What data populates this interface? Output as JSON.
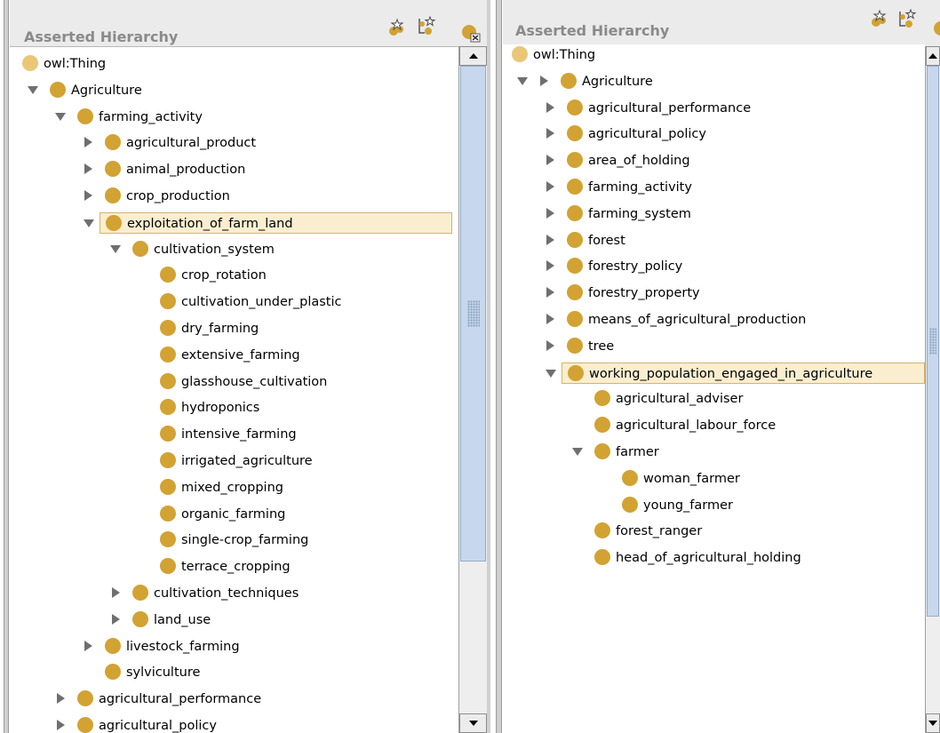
{
  "left": {
    "title": "Asserted Hierarchy",
    "tree": [
      {
        "label": "owl:Thing",
        "toggle": "none",
        "node": "light",
        "level": 0
      },
      {
        "label": "Agriculture",
        "toggle": "down",
        "node": "dark",
        "level": 1
      },
      {
        "label": "farming_activity",
        "toggle": "down",
        "node": "dark",
        "level": 2
      },
      {
        "label": "agricultural_product",
        "toggle": "right",
        "node": "dark",
        "level": 3
      },
      {
        "label": "animal_production",
        "toggle": "right",
        "node": "dark",
        "level": 3
      },
      {
        "label": "crop_production",
        "toggle": "right",
        "node": "dark",
        "level": 3
      },
      {
        "label": "exploitation_of_farm_land",
        "toggle": "down",
        "node": "dark",
        "level": 3,
        "selected": true
      },
      {
        "label": "cultivation_system",
        "toggle": "down",
        "node": "dark",
        "level": 4
      },
      {
        "label": "crop_rotation",
        "toggle": "none",
        "node": "dark",
        "level": 5
      },
      {
        "label": "cultivation_under_plastic",
        "toggle": "none",
        "node": "dark",
        "level": 5
      },
      {
        "label": "dry_farming",
        "toggle": "none",
        "node": "dark",
        "level": 5
      },
      {
        "label": "extensive_farming",
        "toggle": "none",
        "node": "dark",
        "level": 5
      },
      {
        "label": "glasshouse_cultivation",
        "toggle": "none",
        "node": "dark",
        "level": 5
      },
      {
        "label": "hydroponics",
        "toggle": "none",
        "node": "dark",
        "level": 5
      },
      {
        "label": "intensive_farming",
        "toggle": "none",
        "node": "dark",
        "level": 5
      },
      {
        "label": "irrigated_agriculture",
        "toggle": "none",
        "node": "dark",
        "level": 5
      },
      {
        "label": "mixed_cropping",
        "toggle": "none",
        "node": "dark",
        "level": 5
      },
      {
        "label": "organic_farming",
        "toggle": "none",
        "node": "dark",
        "level": 5
      },
      {
        "label": "single-crop_farming",
        "toggle": "none",
        "node": "dark",
        "level": 5
      },
      {
        "label": "terrace_cropping",
        "toggle": "none",
        "node": "dark",
        "level": 5
      },
      {
        "label": "cultivation_techniques",
        "toggle": "right",
        "node": "dark",
        "level": 4
      },
      {
        "label": "land_use",
        "toggle": "right",
        "node": "dark",
        "level": 4
      },
      {
        "label": "livestock_farming",
        "toggle": "right",
        "node": "dark",
        "level": 3
      },
      {
        "label": "sylviculture",
        "toggle": "none",
        "node": "dark",
        "level": 3
      },
      {
        "label": "agricultural_performance",
        "toggle": "right",
        "node": "dark",
        "level": 2
      },
      {
        "label": "agricultural_policy",
        "toggle": "right",
        "node": "dark",
        "level": 2
      }
    ]
  },
  "right": {
    "title": "Asserted Hierarchy",
    "tree": [
      {
        "label": "owl:Thing",
        "toggle": "none",
        "node": "light",
        "level": 0
      },
      {
        "label": "Agriculture",
        "toggle": "down",
        "toggle2": "right",
        "node": "dark",
        "level": 1
      },
      {
        "label": "agricultural_performance",
        "toggle": "right",
        "node": "dark",
        "level": 2
      },
      {
        "label": "agricultural_policy",
        "toggle": "right",
        "node": "dark",
        "level": 2
      },
      {
        "label": "area_of_holding",
        "toggle": "right",
        "node": "dark",
        "level": 2
      },
      {
        "label": "farming_activity",
        "toggle": "right",
        "node": "dark",
        "level": 2
      },
      {
        "label": "farming_system",
        "toggle": "right",
        "node": "dark",
        "level": 2
      },
      {
        "label": "forest",
        "toggle": "right",
        "node": "dark",
        "level": 2
      },
      {
        "label": "forestry_policy",
        "toggle": "right",
        "node": "dark",
        "level": 2
      },
      {
        "label": "forestry_property",
        "toggle": "right",
        "node": "dark",
        "level": 2
      },
      {
        "label": "means_of_agricultural_production",
        "toggle": "right",
        "node": "dark",
        "level": 2
      },
      {
        "label": "tree",
        "toggle": "right",
        "node": "dark",
        "level": 2
      },
      {
        "label": "working_population_engaged_in_agriculture",
        "toggle": "down",
        "node": "dark",
        "level": 2,
        "selected": true
      },
      {
        "label": "agricultural_adviser",
        "toggle": "none",
        "node": "dark",
        "level": 3
      },
      {
        "label": "agricultural_labour_force",
        "toggle": "none",
        "node": "dark",
        "level": 3
      },
      {
        "label": "farmer",
        "toggle": "down",
        "node": "dark",
        "level": 3
      },
      {
        "label": "woman_farmer",
        "toggle": "none",
        "node": "dark",
        "level": 4
      },
      {
        "label": "young_farmer",
        "toggle": "none",
        "node": "dark",
        "level": 4
      },
      {
        "label": "forest_ranger",
        "toggle": "none",
        "node": "dark",
        "level": 3
      },
      {
        "label": "head_of_agricultural_holding",
        "toggle": "none",
        "node": "dark",
        "level": 3
      }
    ]
  },
  "icons": [
    "add-subclass-icon",
    "add-sibling-icon",
    "delete-class-icon"
  ],
  "colors": {
    "node": "#d2a233",
    "node_light": "#eac777",
    "selection_bg": "#fbeed0",
    "selection_border": "#d7b26b",
    "title": "#8a8a8a"
  }
}
